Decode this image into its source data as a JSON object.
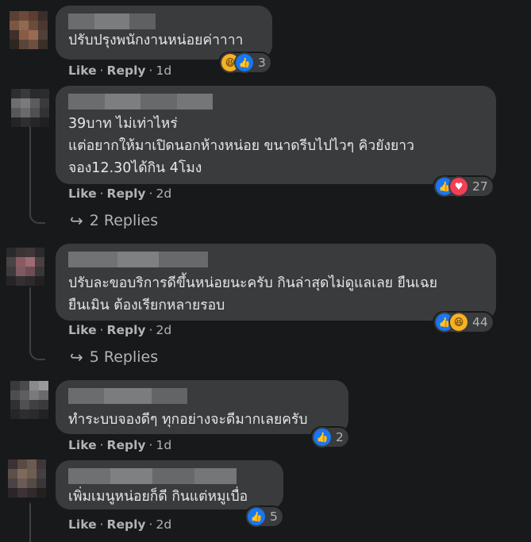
{
  "comments": [
    {
      "text": "ปรับปรุงพนักงานหน่อยค่าาาา",
      "reaction_count": "3",
      "like": "Like",
      "reply": "Reply",
      "time": "1d"
    },
    {
      "text": "39บาท ไม่เท่าไหร่\nแต่อยากให้มาเปิดนอกห้างหน่อย ขนาดรีบไปไวๆ คิวยังยาว\nจอง12.30ได้กิน 4โมง",
      "reaction_count": "27",
      "like": "Like",
      "reply": "Reply",
      "time": "2d",
      "replies": "2 Replies"
    },
    {
      "text": "ปรับละขอบริการดีขึ้นหน่อยนะครับ กินล่าสุดไม่ดูแลเลย ยืนเฉย\nยืนเมิน ต้องเรียกหลายรอบ",
      "reaction_count": "44",
      "like": "Like",
      "reply": "Reply",
      "time": "2d",
      "replies": "5 Replies"
    },
    {
      "text": "ทำระบบจองดีๆ ทุกอย่างจะดีมากเลยครับ",
      "reaction_count": "2",
      "like": "Like",
      "reply": "Reply",
      "time": "1d"
    },
    {
      "text": "เพิ่มเมนูหน่อยก็ดี กินแต่หมูเบื่อ",
      "reaction_count": "5",
      "like": "Like",
      "reply": "Reply",
      "time": "2d"
    }
  ],
  "icons": {
    "like": "like-reaction-icon",
    "love": "love-reaction-icon",
    "haha": "haha-reaction-icon",
    "reply_arrow": "reply-arrow-icon"
  },
  "colors": {
    "background": "#18191a",
    "bubble": "#3a3b3c",
    "text": "#e4e6eb",
    "secondary_text": "#b0b3b8",
    "like_blue": "#1877f2",
    "love_red": "#f33e58",
    "haha_yellow": "#f7b125"
  }
}
